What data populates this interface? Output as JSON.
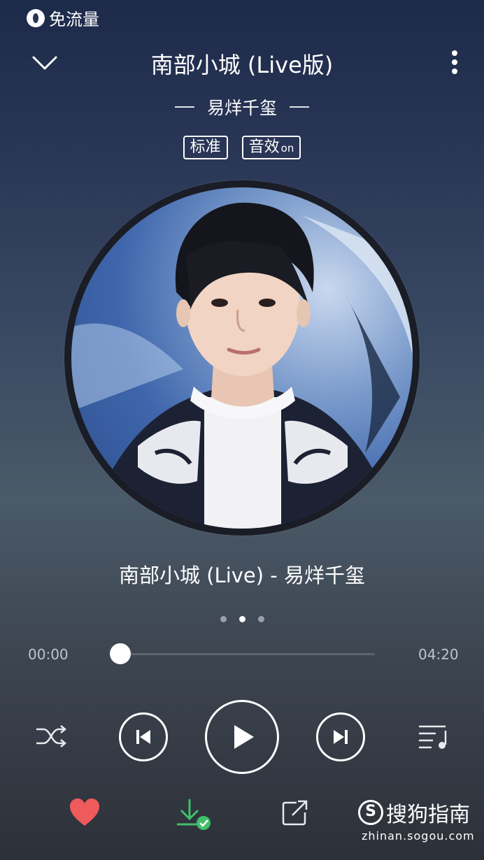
{
  "status_bar": {
    "data_saver_label": "免流量"
  },
  "header": {
    "title": "南部小城 (Live版)",
    "artist": "易烊千玺",
    "quality_badge": "标准",
    "effect_badge": "音效",
    "effect_state": "on"
  },
  "now_playing": {
    "song_line": "南部小城 (Live) - 易烊千玺"
  },
  "pager": {
    "count": 3,
    "active_index": 1
  },
  "progress": {
    "current_time": "00:00",
    "total_time": "04:20",
    "fraction": 0.0
  },
  "watermark": {
    "brand": "搜狗指南",
    "url": "zhinan.sogou.com"
  },
  "colors": {
    "favorite": "#ef5a5a",
    "download": "#3fbf6a",
    "icon": "#e8eaee"
  }
}
